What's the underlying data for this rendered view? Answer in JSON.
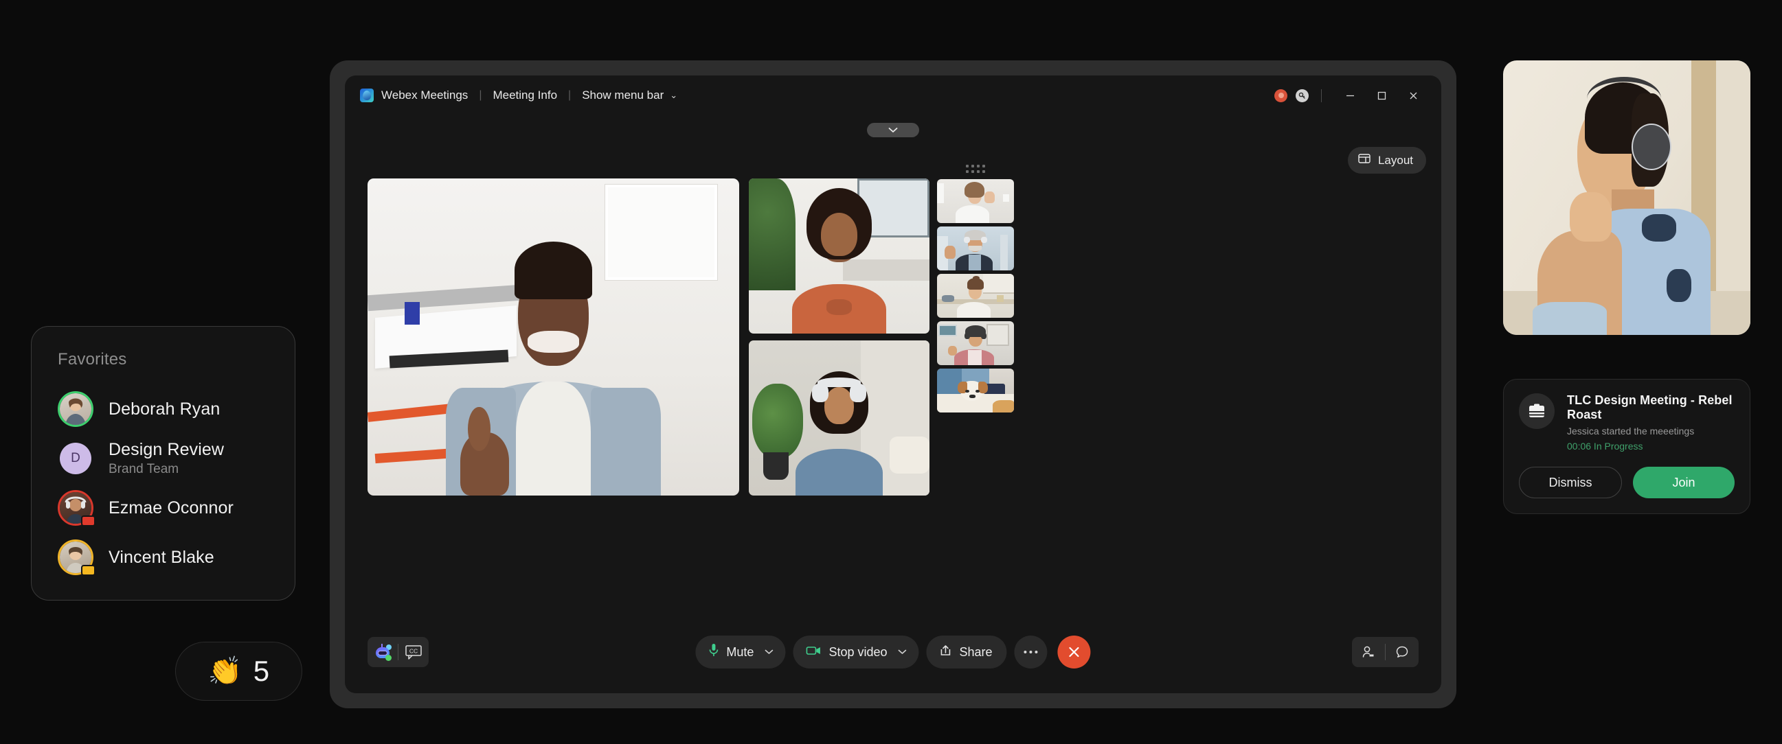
{
  "favorites": {
    "title": "Favorites",
    "items": [
      {
        "name": "Deborah Ryan",
        "sub": "",
        "avatar_initial": "",
        "ring_color": "#3ecf6e",
        "badge_color": ""
      },
      {
        "name": "Design Review",
        "sub": "Brand Team",
        "avatar_initial": "D",
        "ring_color": "#c9b6e8",
        "badge_color": ""
      },
      {
        "name": "Ezmae Oconnor",
        "sub": "",
        "avatar_initial": "",
        "ring_color": "#d9382c",
        "badge_color": "#e03a2c"
      },
      {
        "name": "Vincent Blake",
        "sub": "",
        "avatar_initial": "",
        "ring_color": "#f0b429",
        "badge_color": "#f5b820"
      }
    ]
  },
  "reaction": {
    "emoji": "👏",
    "count": "5"
  },
  "window": {
    "app_name": "Webex Meetings",
    "meeting_info": "Meeting Info",
    "menu_bar": "Show menu bar",
    "separator": "|",
    "chevron": "⌄",
    "recording_label": "recording-indicator",
    "key_label": "🔑",
    "minimize": "minimize",
    "maximize": "maximize",
    "close": "close"
  },
  "layout_button": {
    "label": "Layout"
  },
  "controls": {
    "assistant_label": "ai-assistant",
    "captions_label": "CC",
    "mute": {
      "label": "Mute",
      "caret": "⌄"
    },
    "video": {
      "label": "Stop video",
      "caret": "⌄"
    },
    "share": {
      "label": "Share"
    },
    "more": {
      "label": "•••"
    },
    "end_call": {
      "label": "✕"
    },
    "participants_label": "participants",
    "chat_label": "chat"
  },
  "notification": {
    "title": "TLC Design Meeting - Rebel Roast",
    "subtitle": "Jessica started the meeetings",
    "status": "00:06  In Progress",
    "dismiss_label": "Dismiss",
    "join_label": "Join",
    "accent_color": "#2fa86a",
    "status_color": "#3fa06a"
  },
  "video_grid": {
    "main_speaker": "man-thumbs-up-blue-corduroy",
    "mid_tiles": [
      "woman-orange-shirt-plant",
      "woman-headphones-blue-shirt"
    ],
    "filmstrip": [
      "woman-waving-white-shirt",
      "older-man-headphones-waving",
      "woman-kitchen-white-top",
      "woman-headphones-pink-jacket",
      "dog-on-couch"
    ],
    "self_view": "man-headphones-light-blue-tshirt"
  }
}
